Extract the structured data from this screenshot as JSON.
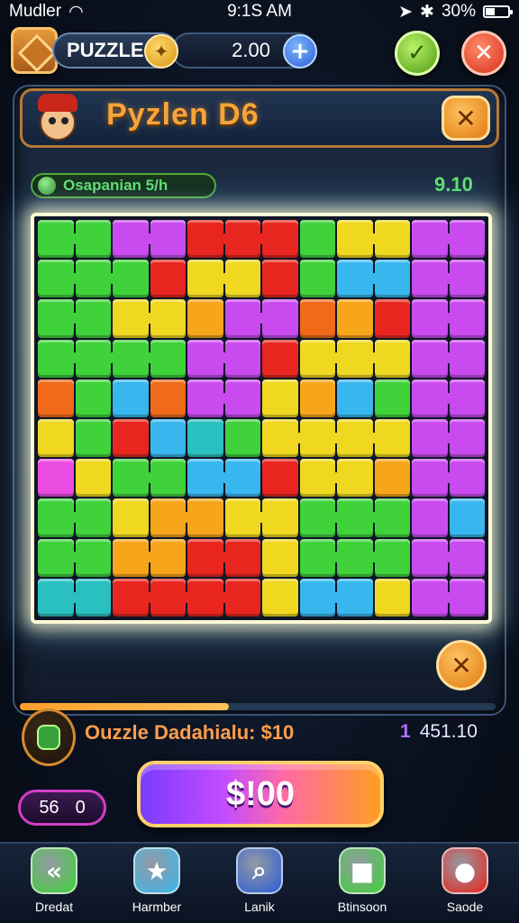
{
  "status_bar": {
    "carrier": "Mudler",
    "time": "9:1S AM",
    "battery": "30%"
  },
  "top_bar": {
    "title": "PUZZLE",
    "score": "2.00",
    "plus_icon": "plus-icon",
    "confirm_icon": "check-icon",
    "close_icon": "close-icon"
  },
  "header": {
    "level_title": "Pyzlen D6"
  },
  "sub": {
    "label": "Osapanian 5/h",
    "timer": "9.10"
  },
  "board": {
    "rows": [
      [
        "#3fd23b",
        "#3fd23b",
        "#c94bef",
        "#c94bef",
        "#e8261f",
        "#e8261f",
        "#e8261f",
        "#3fd23b",
        "#f0d820",
        "#f0d820",
        "#c94bef",
        "#c94bef"
      ],
      [
        "#3fd23b",
        "#3fd23b",
        "#3fd23b",
        "#e8261f",
        "#f0d820",
        "#f0d820",
        "#e8261f",
        "#3fd23b",
        "#38b7ee",
        "#38b7ee",
        "#c94bef",
        "#c94bef"
      ],
      [
        "#3fd23b",
        "#3fd23b",
        "#f0d820",
        "#f0d820",
        "#f7a51a",
        "#c94bef",
        "#c94bef",
        "#f06a1a",
        "#f7a51a",
        "#e8261f",
        "#c94bef",
        "#c94bef"
      ],
      [
        "#3fd23b",
        "#3fd23b",
        "#3fd23b",
        "#3fd23b",
        "#c94bef",
        "#c94bef",
        "#e8261f",
        "#f0d820",
        "#f0d820",
        "#f0d820",
        "#c94bef",
        "#c94bef"
      ],
      [
        "#f06a1a",
        "#3fd23b",
        "#38b7ee",
        "#f06a1a",
        "#c94bef",
        "#c94bef",
        "#f0d820",
        "#f7a51a",
        "#38b7ee",
        "#3fd23b",
        "#c94bef",
        "#c94bef"
      ],
      [
        "#f0d820",
        "#3fd23b",
        "#e8261f",
        "#38b7ee",
        "#2bc0c0",
        "#3fd23b",
        "#f0d820",
        "#f0d820",
        "#f0d820",
        "#f0d820",
        "#c94bef",
        "#c94bef"
      ],
      [
        "#e84ce0",
        "#f0d820",
        "#3fd23b",
        "#3fd23b",
        "#38b7ee",
        "#38b7ee",
        "#e8261f",
        "#f0d820",
        "#f0d820",
        "#f7a51a",
        "#c94bef",
        "#c94bef"
      ],
      [
        "#3fd23b",
        "#3fd23b",
        "#f0d820",
        "#f7a51a",
        "#f7a51a",
        "#f0d820",
        "#f0d820",
        "#3fd23b",
        "#3fd23b",
        "#3fd23b",
        "#c94bef",
        "#38b7ee"
      ],
      [
        "#3fd23b",
        "#3fd23b",
        "#f7a51a",
        "#f7a51a",
        "#e8261f",
        "#e8261f",
        "#f0d820",
        "#3fd23b",
        "#3fd23b",
        "#3fd23b",
        "#c94bef",
        "#c94bef"
      ],
      [
        "#2bc0c0",
        "#2bc0c0",
        "#e8261f",
        "#e8261f",
        "#e8261f",
        "#e8261f",
        "#f0d820",
        "#38b7ee",
        "#38b7ee",
        "#f0d820",
        "#c94bef",
        "#c94bef"
      ]
    ]
  },
  "progress": {
    "fraction": 0.44
  },
  "info": {
    "label": "Ouzzle Dadahialu: $10",
    "count": "1",
    "value": "451.10"
  },
  "action": {
    "left_value": "56",
    "left_count": "0",
    "buy_label": "$!00"
  },
  "nav": [
    {
      "label": "Dredat",
      "icon": "back-arrows-icon",
      "color": "#3fd23b",
      "glyph": "«"
    },
    {
      "label": "Harmber",
      "icon": "star-icon",
      "color": "#38b7ee",
      "glyph": "★"
    },
    {
      "label": "Lanik",
      "icon": "magnifier-icon",
      "color": "#2a5fd6",
      "glyph": "⌕"
    },
    {
      "label": "Btinsoon",
      "icon": "square-icon",
      "color": "#3fd23b",
      "glyph": "■"
    },
    {
      "label": "Saode",
      "icon": "gem-icon",
      "color": "#e8261f",
      "glyph": "●"
    }
  ]
}
